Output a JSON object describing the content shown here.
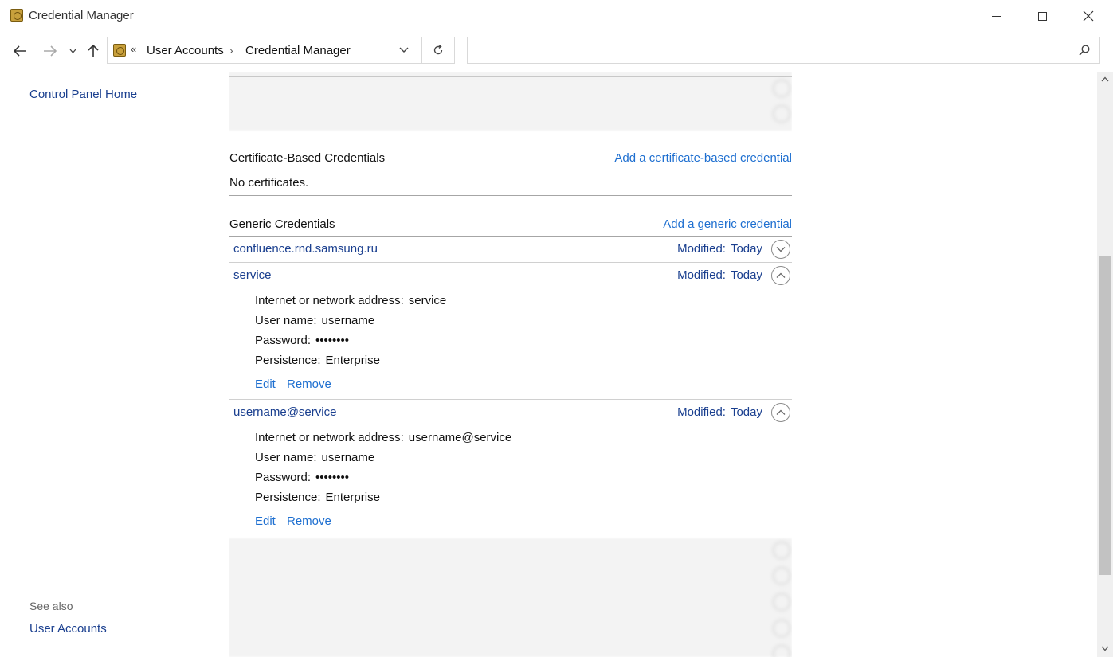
{
  "window": {
    "title": "Credential Manager"
  },
  "address_bar": {
    "overflow_chevron": "«",
    "breadcrumbs": [
      "User Accounts",
      "Credential Manager"
    ],
    "separator": "›",
    "search_placeholder": ""
  },
  "left_pane": {
    "control_panel_home": "Control Panel Home",
    "see_also": "See also",
    "user_accounts": "User Accounts"
  },
  "certificate_section": {
    "title": "Certificate-Based Credentials",
    "add_link": "Add a certificate-based credential",
    "empty_text": "No certificates."
  },
  "generic_section": {
    "title": "Generic Credentials",
    "add_link": "Add a generic credential",
    "modified_label": "Modified:",
    "credentials": [
      {
        "name": "confluence.rnd.samsung.ru",
        "modified": "Today",
        "expanded": false
      },
      {
        "name": "service",
        "modified": "Today",
        "expanded": true,
        "address_label": "Internet or network address:",
        "address": "service",
        "username_label": "User name:",
        "username": "username",
        "password_label": "Password:",
        "password": "••••••••",
        "persistence_label": "Persistence:",
        "persistence": "Enterprise",
        "edit": "Edit",
        "remove": "Remove"
      },
      {
        "name": "username@service",
        "modified": "Today",
        "expanded": true,
        "address_label": "Internet or network address:",
        "address": "username@service",
        "username_label": "User name:",
        "username": "username",
        "password_label": "Password:",
        "password": "••••••••",
        "persistence_label": "Persistence:",
        "persistence": "Enterprise",
        "edit": "Edit",
        "remove": "Remove"
      }
    ]
  },
  "colors": {
    "link_dark": "#1a3f8f",
    "link_action": "#1e6fd0",
    "divider": "#a6a6a6"
  }
}
